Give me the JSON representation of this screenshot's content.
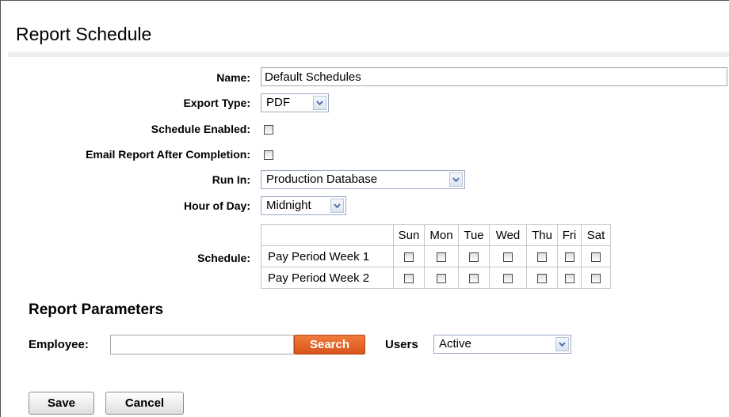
{
  "page": {
    "title": "Report Schedule"
  },
  "form": {
    "name": {
      "label": "Name:",
      "value": "Default Schedules"
    },
    "export_type": {
      "label": "Export Type:",
      "selected": "PDF"
    },
    "schedule_enabled": {
      "label": "Schedule Enabled:",
      "checked": false
    },
    "email_report": {
      "label": "Email Report After Completion:",
      "checked": false
    },
    "run_in": {
      "label": "Run In:",
      "selected": "Production Database"
    },
    "hour_of_day": {
      "label": "Hour of Day:",
      "selected": "Midnight"
    },
    "schedule": {
      "label": "Schedule:",
      "days": [
        "Sun",
        "Mon",
        "Tue",
        "Wed",
        "Thu",
        "Fri",
        "Sat"
      ],
      "weeks": [
        {
          "label": "Pay Period Week 1",
          "checked": [
            false,
            false,
            false,
            false,
            false,
            false,
            false
          ]
        },
        {
          "label": "Pay Period Week 2",
          "checked": [
            false,
            false,
            false,
            false,
            false,
            false,
            false
          ]
        }
      ]
    }
  },
  "parameters": {
    "heading": "Report Parameters",
    "employee": {
      "label": "Employee:",
      "value": ""
    },
    "search_label": "Search",
    "users": {
      "label": "Users",
      "selected": "Active"
    }
  },
  "actions": {
    "save_label": "Save",
    "cancel_label": "Cancel"
  },
  "colors": {
    "search_button": "#e2622a",
    "select_border": "#9aa9c2"
  }
}
